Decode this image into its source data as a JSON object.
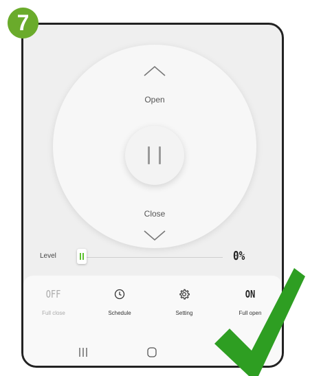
{
  "step_badge": "7",
  "dial": {
    "open_label": "Open",
    "close_label": "Close",
    "up_icon": "chevron-up-icon",
    "down_icon": "chevron-down-icon",
    "pause_icon": "pause-icon"
  },
  "level": {
    "label": "Level",
    "value_text": "0%",
    "value_fraction": 0.0
  },
  "actions": [
    {
      "top_text": "OFF",
      "label": "Full close"
    },
    {
      "icon": "clock-icon",
      "label": "Schedule"
    },
    {
      "icon": "gear-icon",
      "label": "Setting"
    },
    {
      "top_text": "ON",
      "label": "Full open"
    }
  ],
  "navbar": {
    "recent_icon": "recent-apps-icon",
    "home_icon": "home-icon"
  },
  "overlay_icon": "checkmark-icon",
  "colors": {
    "accent_green": "#6aab2b",
    "slider_green": "#5cc12e",
    "check_green": "#2e9e22"
  }
}
